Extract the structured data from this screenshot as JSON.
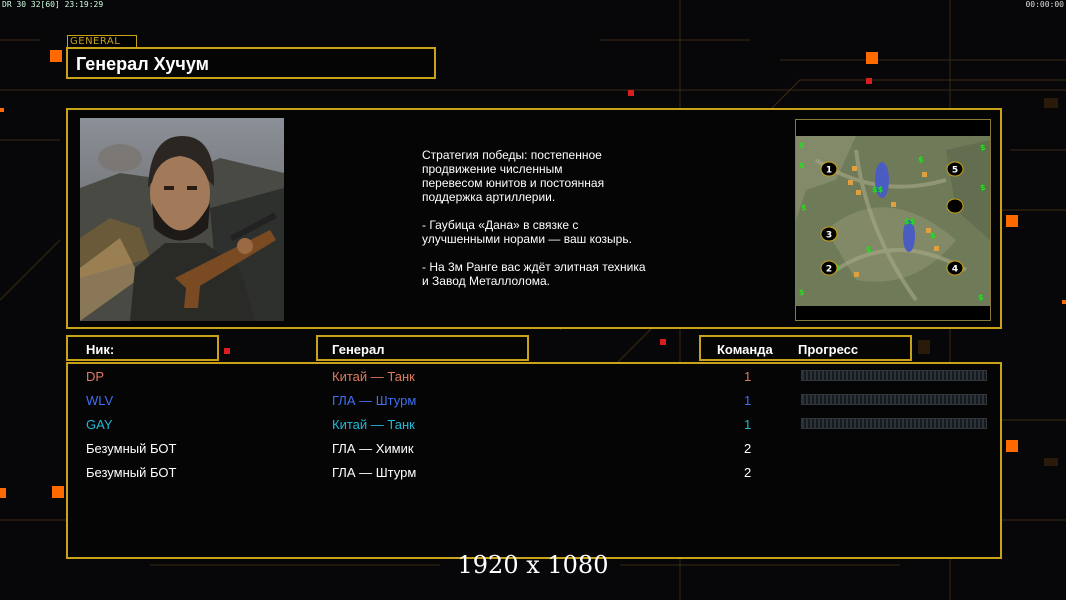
{
  "hud": {
    "left_text": "DR 30 32[60] 23:19:29",
    "right_text": "00:00:00"
  },
  "colors": {
    "accent": "#c9a21a",
    "orange": "#ff6a00"
  },
  "general_tag": "GENERAL",
  "title": "Генерал Хучум",
  "strategy_text": "Стратегия победы: постепенное\nпродвижение численным\nперевесом юнитов и постоянная\nподдержка артиллерии.\n\n- Гаубица «Дана» в связке с\nулучшенными норами — ваш козырь.\n\n- На 3м Ранге вас ждёт элитная техника\nи Завод Металлолома.",
  "minimap": {
    "slots": [
      "1",
      "2",
      "3",
      "4",
      "5",
      ""
    ]
  },
  "columns": {
    "nick": "Ник:",
    "general": "Генерал",
    "team": "Команда",
    "progress": "Прогресс"
  },
  "players": [
    {
      "nick": "DP",
      "general": "Китай — Танк",
      "team": "1",
      "color": "#e07a5f",
      "team_color": "#e07a5f",
      "progress": 0,
      "show_bar": true
    },
    {
      "nick": "WLV",
      "general": "ГЛА — Штурм",
      "team": "1",
      "color": "#3f6ff2",
      "team_color": "#3f6ff2",
      "progress": 0,
      "show_bar": true
    },
    {
      "nick": "GAY",
      "general": "Китай — Танк",
      "team": "1",
      "color": "#22b8d8",
      "team_color": "#22b8d8",
      "progress": 0,
      "show_bar": true
    },
    {
      "nick": "Безумный БОТ",
      "general": "ГЛА — Химик",
      "team": "2",
      "color": "#ffffff",
      "team_color": "#ffffff",
      "progress": 0,
      "show_bar": false
    },
    {
      "nick": "Безумный БОТ",
      "general": "ГЛА — Штурм",
      "team": "2",
      "color": "#ffffff",
      "team_color": "#ffffff",
      "progress": 0,
      "show_bar": false
    }
  ],
  "resolution_label": "1920 x 1080"
}
